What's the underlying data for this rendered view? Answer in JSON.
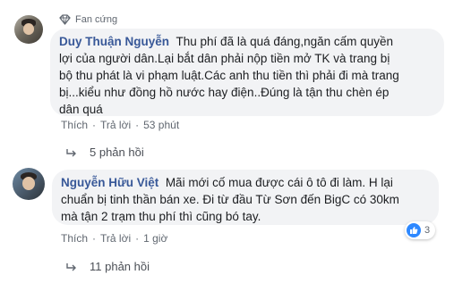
{
  "comments": [
    {
      "badge": "Fan cứng",
      "author": "Duy Thuận Nguyễn",
      "lines": [
        "Thu phí đã là quá đáng,ngăn cấm quyền",
        "lợi của người dân.Lại bắt dân phải nộp tiền mở TK và trang bị",
        "bộ thu phát là vi phạm luật.Các anh thu tiền thì phải đi mà trang",
        "bị...kiểu như đồng hồ nước hay điện..Đúng là tận thu chèn ép",
        "dân quá"
      ],
      "like": "Thích",
      "reply": "Trả lời",
      "time": "53 phút",
      "replies": "5 phản hồi"
    },
    {
      "author": "Nguyễn Hữu Việt",
      "lines": [
        "Mãi mới cố mua được cái ô tô đi làm. H lại",
        "chuẩn bị tinh thần bán xe. Đi từ đầu Từ Sơn đến BigC có 30km",
        "mà tận 2 trạm thu phí thì cũng bó tay."
      ],
      "like": "Thích",
      "reply": "Trả lời",
      "time": "1 giờ",
      "reaction_count": "3",
      "replies": "11 phản hồi"
    }
  ],
  "separator": "·",
  "colors": {
    "link": "#385898",
    "bubble": "#f2f3f5",
    "like_blue": "#2d88ff"
  },
  "icons": [
    "diamond-icon",
    "reply-arrow-icon",
    "like-icon"
  ]
}
